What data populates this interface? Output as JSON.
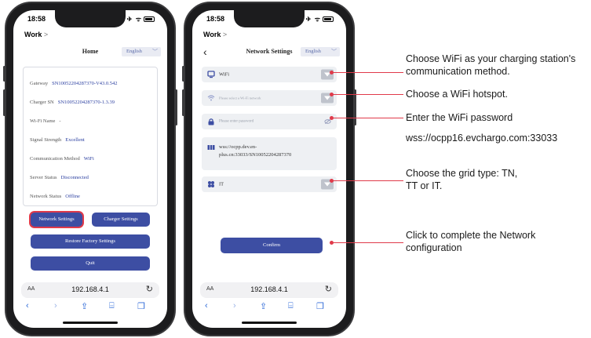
{
  "status_bar": {
    "time": "18:58",
    "icons": "✈ ᯤ"
  },
  "breadcrumb": {
    "work": "Work",
    "chevron": ">"
  },
  "home_screen": {
    "title": "Home",
    "language": "English",
    "rows": [
      {
        "label": "Gateway",
        "value": "SN10052204287370-V43.0.542"
      },
      {
        "label": "Charger SN",
        "value": "SN10052204287370-1.3.39"
      },
      {
        "label": "Wi-Fi Name",
        "value": "-"
      },
      {
        "label": "Signal Strength",
        "value": "Excellent"
      },
      {
        "label": "Communication Method",
        "value": "WiFi"
      },
      {
        "label": "Server Status",
        "value": "Disconnected"
      },
      {
        "label": "Network Status",
        "value": "Offline"
      }
    ],
    "buttons": {
      "network_settings": "Network Settings",
      "charger_settings": "Charger Settings",
      "restore_factory": "Restore Factory Settings",
      "quit": "Quit"
    }
  },
  "network_screen": {
    "title": "Network Settings",
    "language": "English",
    "comm_method": "WiFi",
    "wifi_placeholder": "Please select a Wi-Fi network",
    "password_placeholder": "Please enter password",
    "server_url": "wss://ocpp.dev.en-plus.cn:33033/SN10052204287370",
    "grid_type": "IT",
    "confirm": "Confirm"
  },
  "browser": {
    "aa": "AA",
    "url": "192.168.4.1",
    "reload": "↻"
  },
  "annotations": {
    "comm_method": "Choose WiFi as your charging station's communication method.",
    "hotspot": "Choose a WiFi hotspot.",
    "password": "Enter the WiFi password",
    "url": "wss://ocpp16.evchargo.com:33033",
    "grid": "Choose the grid type: TN, TT or IT.",
    "confirm": "Click to complete the Network configuration"
  },
  "colors": {
    "accent": "#3d4ea3",
    "highlight": "#e03a4a",
    "link_value": "#2b3fa0"
  }
}
